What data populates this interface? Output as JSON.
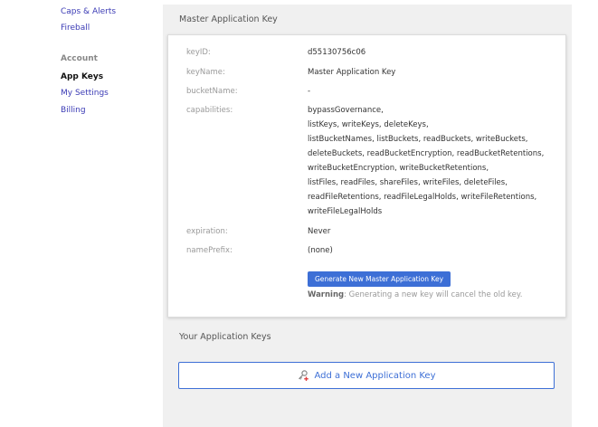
{
  "sidebar": {
    "links_top": [
      {
        "label": "Caps & Alerts"
      },
      {
        "label": "Fireball"
      }
    ],
    "account_heading": "Account",
    "account_links": [
      {
        "label": "App Keys",
        "active": true
      },
      {
        "label": "My Settings"
      },
      {
        "label": "Billing"
      }
    ]
  },
  "master_key": {
    "title": "Master Application Key",
    "fields": {
      "key_id": {
        "label": "keyID:",
        "value": "d55130756c06"
      },
      "key_name": {
        "label": "keyName:",
        "value": "Master Application Key"
      },
      "bucket_name": {
        "label": "bucketName:",
        "value": "-"
      },
      "capabilities": {
        "label": "capabilities:",
        "lines": [
          "bypassGovernance,",
          "listKeys, writeKeys, deleteKeys,",
          "listBucketNames, listBuckets, readBuckets, writeBuckets,",
          "deleteBuckets, readBucketEncryption, readBucketRetentions,",
          "writeBucketEncryption, writeBucketRetentions,",
          "listFiles, readFiles, shareFiles, writeFiles, deleteFiles,",
          "readFileRetentions, readFileLegalHolds, writeFileRetentions,",
          "writeFileLegalHolds"
        ]
      },
      "expiration": {
        "label": "expiration:",
        "value": "Never"
      },
      "name_prefix": {
        "label": "namePrefix:",
        "value": "(none)"
      }
    },
    "generate_button": "Generate New Master Application Key",
    "warning_label": "Warning",
    "warning_text": ": Generating a new key will cancel the old key."
  },
  "app_keys": {
    "title": "Your Application Keys",
    "add_button": "Add a New Application Key",
    "add_icon": "add-key-icon"
  },
  "colors": {
    "accent": "#3d6fd6",
    "link": "#3b3bb5",
    "panel_bg": "#f0f0f0"
  }
}
